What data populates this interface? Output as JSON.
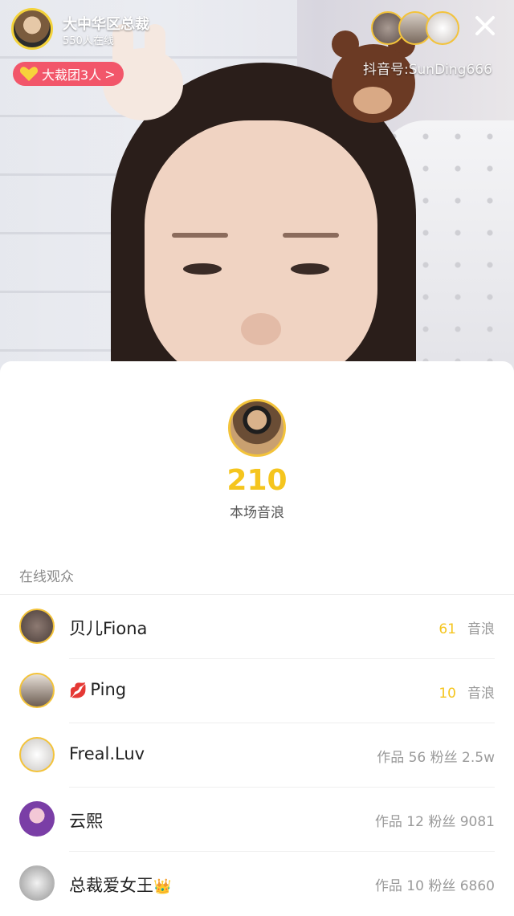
{
  "host": {
    "name": "大中华区总裁",
    "online": "550人在线",
    "fan_club": "大裁团3人",
    "douyin_id": "抖音号:SunDing666"
  },
  "sheet": {
    "score": "210",
    "score_label": "本场音浪",
    "section_title": "在线观众"
  },
  "viewers": [
    {
      "name": "贝儿Fiona",
      "value": "61",
      "unit": "音浪"
    },
    {
      "name": "Ping",
      "value": "10",
      "unit": "音浪",
      "prefix_icon": "lips-icon"
    },
    {
      "name": "Freal.Luv",
      "stats": "作品 56  粉丝 2.5w"
    },
    {
      "name": "云熙",
      "stats": "作品 12  粉丝 9081"
    },
    {
      "name": "总裁爱女王",
      "stats": "作品 10  粉丝 6860",
      "suffix_icon": "crown-icon"
    }
  ],
  "colors": {
    "accent_gold": "#f5c51e",
    "badge_pink": "#f2566a"
  }
}
